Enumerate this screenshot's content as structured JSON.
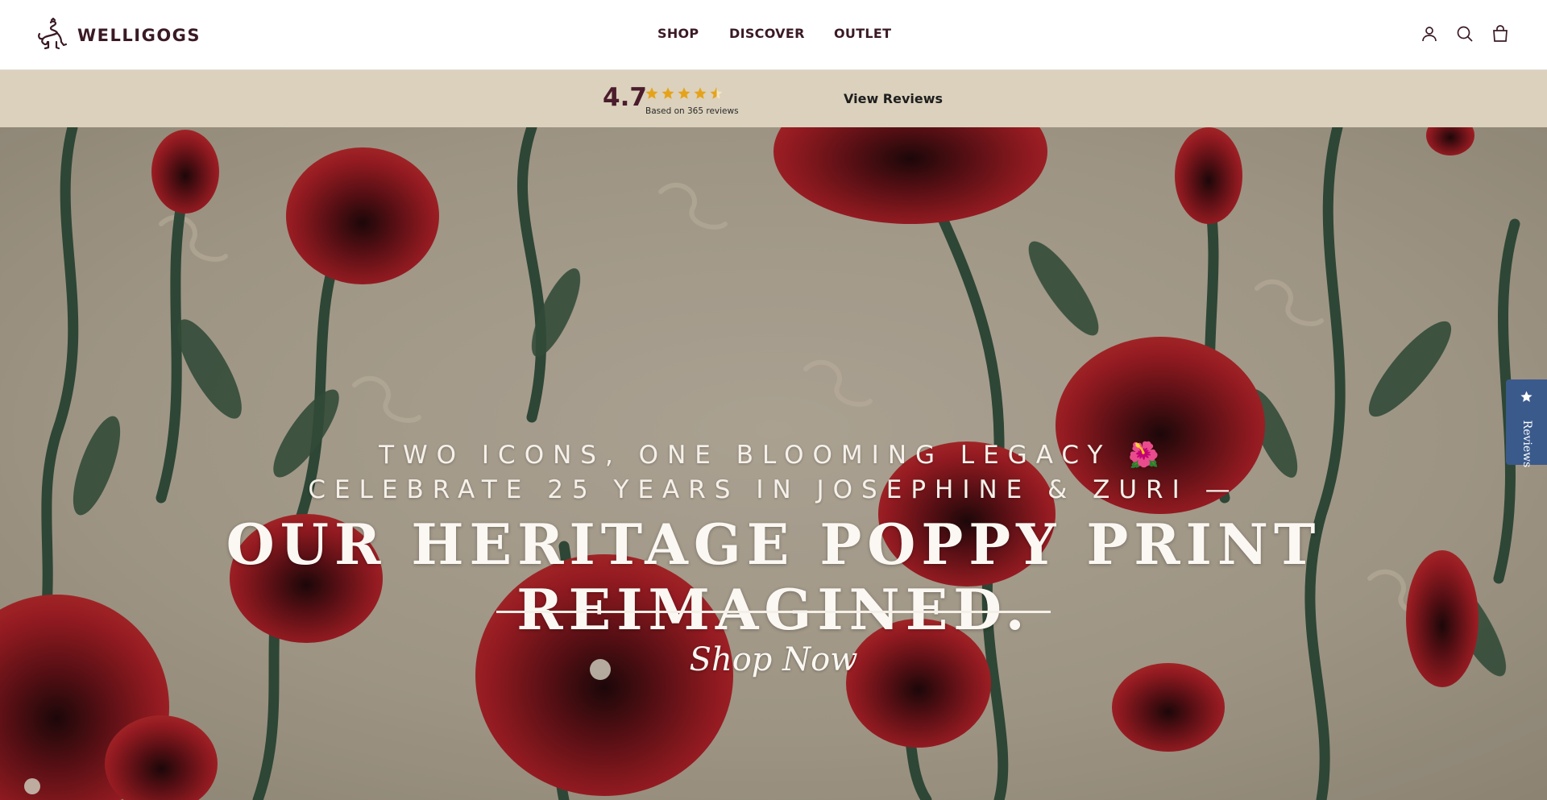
{
  "brand": {
    "name": "WELLIGOGS",
    "logo_icon": "lion-logo-icon"
  },
  "nav": {
    "items": [
      "SHOP",
      "DISCOVER",
      "OUTLET"
    ]
  },
  "header_icons": [
    "account-icon",
    "search-icon",
    "cart-bag-icon"
  ],
  "reviews_bar": {
    "rating": "4.7",
    "stars": 4.7,
    "based_on": "Based on 365 reviews",
    "view_reviews": "View Reviews"
  },
  "hero": {
    "line1": "TWO ICONS, ONE BLOOMING LEGACY 🌺",
    "line2": "CELEBRATE 25 YEARS IN JOSEPHINE & ZURI —",
    "title": "OUR HERITAGE POPPY PRINT REIMAGINED.",
    "cta": "Shop Now"
  },
  "side_tab": {
    "label": "Reviews",
    "icon": "star-icon"
  },
  "colors": {
    "brand_text": "#3a1a24",
    "rating_bar_bg": "#dbd1bc",
    "star": "#e6a31a",
    "side_tab_bg": "#3a5a8c",
    "hero_text": "#fbf8f3"
  }
}
